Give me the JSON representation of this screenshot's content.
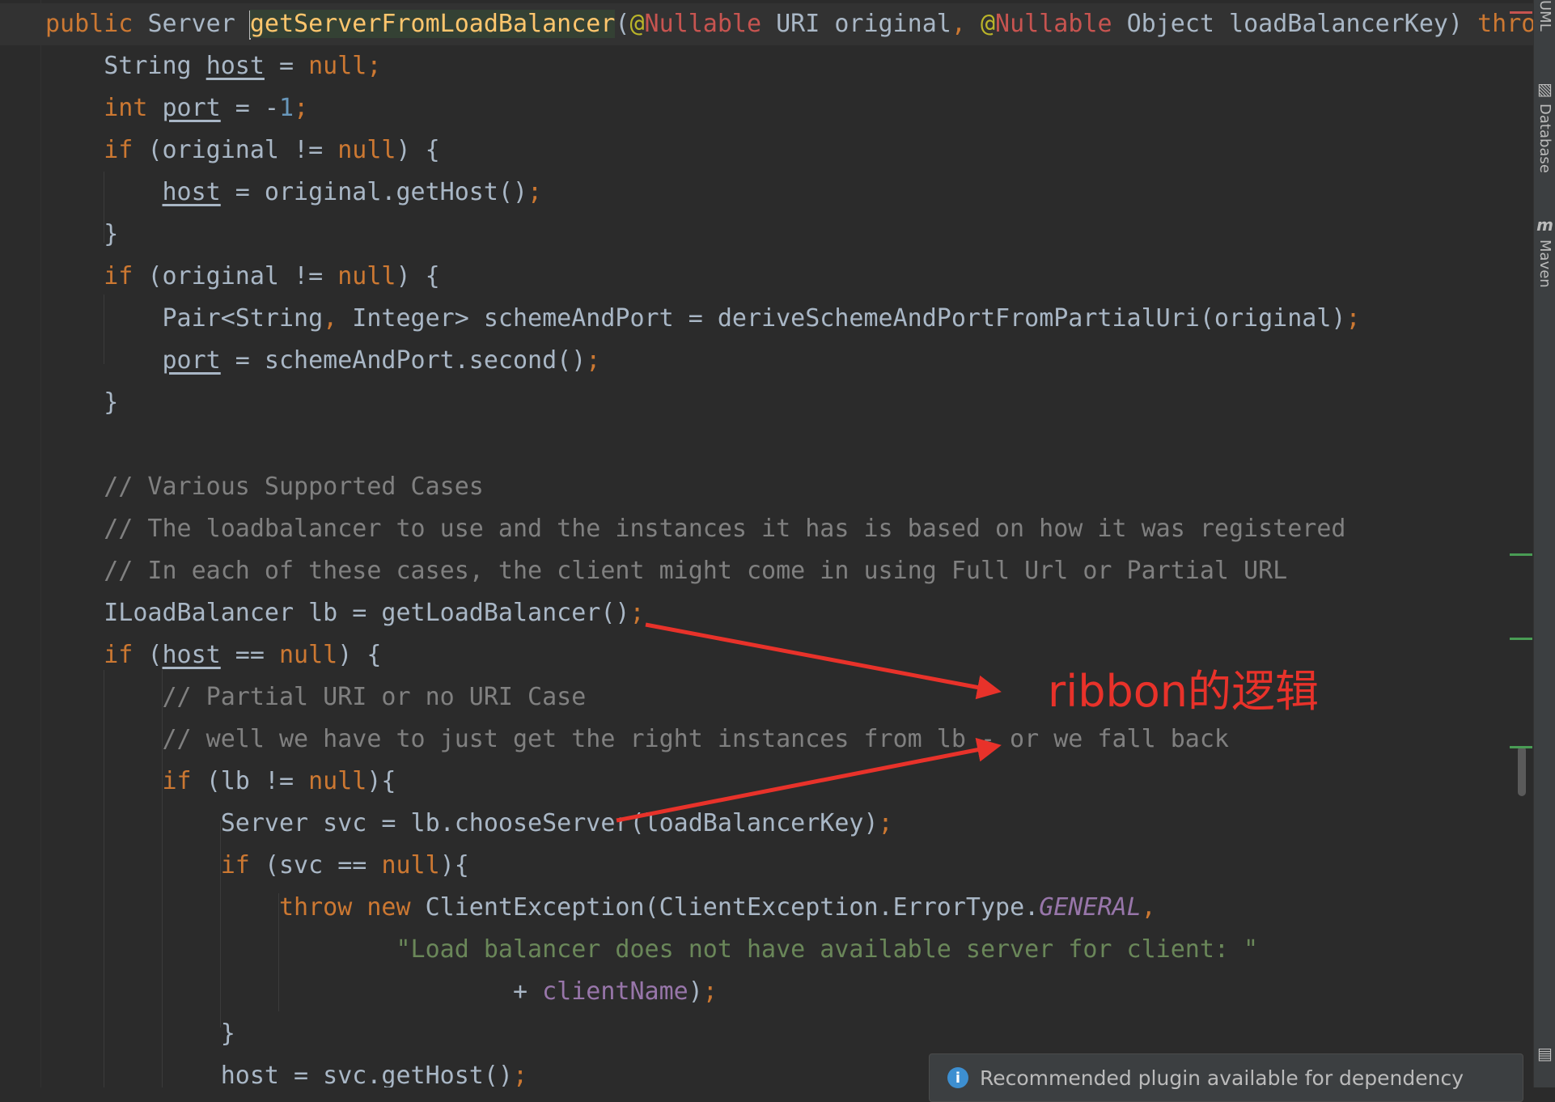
{
  "editor": {
    "lines": [
      [
        [
          "kw",
          "public "
        ],
        [
          "text",
          "Server "
        ],
        [
          "caret",
          ""
        ],
        [
          "method",
          "getServerFromLoadBalancer"
        ],
        [
          "text",
          "("
        ],
        [
          "ann",
          "@"
        ],
        [
          "nullable",
          "Nullable"
        ],
        [
          "text",
          " URI original"
        ],
        [
          "punct",
          ", "
        ],
        [
          "ann",
          "@"
        ],
        [
          "nullable",
          "Nullable"
        ],
        [
          "text",
          " Object loadBalancerKey) "
        ],
        [
          "kw",
          "throws"
        ]
      ],
      [
        [
          "text",
          "    String "
        ],
        [
          "var",
          "host"
        ],
        [
          "text",
          " = "
        ],
        [
          "kw",
          "null"
        ],
        [
          "punct",
          ";"
        ]
      ],
      [
        [
          "text",
          "    "
        ],
        [
          "kw",
          "int "
        ],
        [
          "var",
          "port"
        ],
        [
          "text",
          " = -"
        ],
        [
          "num",
          "1"
        ],
        [
          "punct",
          ";"
        ]
      ],
      [
        [
          "text",
          "    "
        ],
        [
          "kw",
          "if "
        ],
        [
          "text",
          "(original != "
        ],
        [
          "kw",
          "null"
        ],
        [
          "text",
          ") {"
        ]
      ],
      [
        [
          "text",
          "        "
        ],
        [
          "var",
          "host"
        ],
        [
          "text",
          " = original.getHost()"
        ],
        [
          "punct",
          ";"
        ]
      ],
      [
        [
          "text",
          "    }"
        ]
      ],
      [
        [
          "text",
          "    "
        ],
        [
          "kw",
          "if "
        ],
        [
          "text",
          "(original != "
        ],
        [
          "kw",
          "null"
        ],
        [
          "text",
          ") {"
        ]
      ],
      [
        [
          "text",
          "        Pair<String"
        ],
        [
          "punct",
          ", "
        ],
        [
          "text",
          "Integer> schemeAndPort = deriveSchemeAndPortFromPartialUri(original)"
        ],
        [
          "punct",
          ";"
        ]
      ],
      [
        [
          "text",
          "        "
        ],
        [
          "var",
          "port"
        ],
        [
          "text",
          " = schemeAndPort.second()"
        ],
        [
          "punct",
          ";"
        ]
      ],
      [
        [
          "text",
          "    }"
        ]
      ],
      [],
      [
        [
          "comment",
          "    // Various Supported Cases"
        ]
      ],
      [
        [
          "comment",
          "    // The loadbalancer to use and the instances it has is based on how it was registered"
        ]
      ],
      [
        [
          "comment",
          "    // In each of these cases, the client might come in using Full Url or Partial URL"
        ]
      ],
      [
        [
          "text",
          "    ILoadBalancer lb = getLoadBalancer()"
        ],
        [
          "punct",
          ";"
        ]
      ],
      [
        [
          "text",
          "    "
        ],
        [
          "kw",
          "if "
        ],
        [
          "text",
          "("
        ],
        [
          "var",
          "host"
        ],
        [
          "text",
          " == "
        ],
        [
          "kw",
          "null"
        ],
        [
          "text",
          ") {"
        ]
      ],
      [
        [
          "comment",
          "        // Partial URI or no URI Case"
        ]
      ],
      [
        [
          "comment",
          "        // well we have to just get the right instances from lb - or we fall back"
        ]
      ],
      [
        [
          "text",
          "        "
        ],
        [
          "kw",
          "if "
        ],
        [
          "text",
          "(lb != "
        ],
        [
          "kw",
          "null"
        ],
        [
          "text",
          "){"
        ]
      ],
      [
        [
          "text",
          "            Server svc = lb.chooseServer(loadBalancerKey)"
        ],
        [
          "punct",
          ";"
        ]
      ],
      [
        [
          "text",
          "            "
        ],
        [
          "kw",
          "if "
        ],
        [
          "text",
          "(svc == "
        ],
        [
          "kw",
          "null"
        ],
        [
          "text",
          "){"
        ]
      ],
      [
        [
          "text",
          "                "
        ],
        [
          "kw",
          "throw new "
        ],
        [
          "text",
          "ClientException(ClientException.ErrorType."
        ],
        [
          "const",
          "GENERAL"
        ],
        [
          "punct",
          ","
        ]
      ],
      [
        [
          "string",
          "                        \"Load balancer does not have available server for client: \""
        ]
      ],
      [
        [
          "text",
          "                                + "
        ],
        [
          "field",
          "clientName"
        ],
        [
          "text",
          ")"
        ],
        [
          "punct",
          ";"
        ]
      ],
      [
        [
          "text",
          "            }"
        ]
      ],
      [
        [
          "text",
          "            "
        ],
        [
          "var",
          "host"
        ],
        [
          "text",
          " = svc.getHost()"
        ],
        [
          "punct",
          ";"
        ]
      ]
    ]
  },
  "annotation": {
    "label": "ribbon的逻辑",
    "color": "#e8322a"
  },
  "right_toolbar": {
    "tabs": [
      {
        "label": "UML",
        "icon": ""
      },
      {
        "label": "Database",
        "icon": "database-icon"
      },
      {
        "label": "Maven",
        "icon": "maven-icon"
      }
    ]
  },
  "notification": {
    "icon": "info-icon",
    "text": "Recommended plugin available for dependency"
  },
  "colors": {
    "background": "#2b2b2b",
    "keyword": "#cc7832",
    "comment": "#808080",
    "string": "#6a8759",
    "number": "#6897bb",
    "field": "#9876aa",
    "nullable": "#c75450",
    "method": "#ffc66d"
  }
}
